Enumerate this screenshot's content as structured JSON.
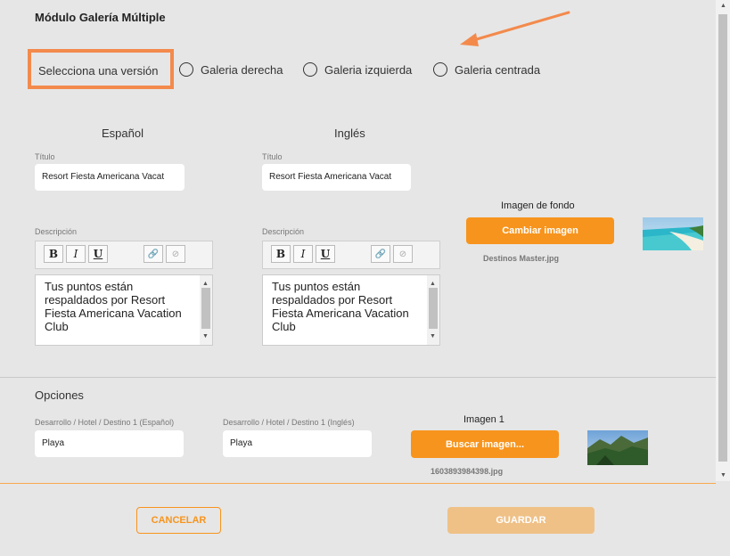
{
  "modal": {
    "title": "Módulo Galería Múltiple"
  },
  "version": {
    "label": "Selecciona una versión",
    "options": [
      "Galeria derecha",
      "Galeria izquierda",
      "Galeria centrada"
    ]
  },
  "spanish": {
    "header": "Español",
    "title_label": "Título",
    "title_value": "Resort Fiesta Americana Vacat",
    "desc_label": "Descripción",
    "desc_value": "Tus puntos están respaldados por Resort Fiesta Americana Vacation Club"
  },
  "english": {
    "header": "Inglés",
    "title_label": "Título",
    "title_value": "Resort Fiesta Americana Vacat",
    "desc_label": "Descripción",
    "desc_value": "Tus puntos están respaldados por Resort Fiesta Americana Vacation Club"
  },
  "toolbar": {
    "bold": "B",
    "italic": "I",
    "underline": "U"
  },
  "background_image": {
    "label": "Imagen de fondo",
    "button": "Cambiar imagen",
    "filename": "Destinos Master.jpg"
  },
  "options": {
    "title": "Opciones",
    "spanish_label": "Desarrollo / Hotel / Destino 1 (Español)",
    "spanish_value": "Playa",
    "english_label": "Desarrollo / Hotel / Destino 1 (Inglés)",
    "english_value": "Playa",
    "image_label": "Imagen 1",
    "image_button": "Buscar imagen...",
    "image_filename": "1603893984398.jpg"
  },
  "footer": {
    "cancel": "CANCELAR",
    "save": "GUARDAR"
  },
  "colors": {
    "accent": "#f7941d",
    "highlight_box": "#f38a4c",
    "save_disabled": "#efc187"
  }
}
